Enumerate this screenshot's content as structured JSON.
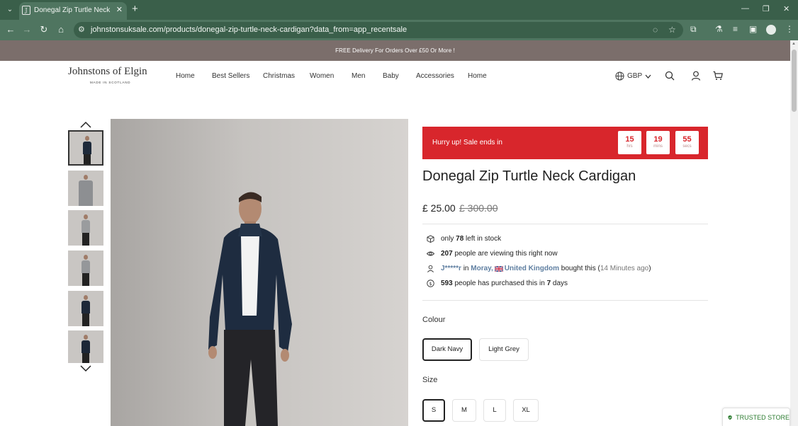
{
  "browser": {
    "tab_title": "Donegal Zip Turtle Neck Cardig",
    "url": "johnstonsuksale.com/products/donegal-zip-turtle-neck-cardigan?data_from=app_recentsale",
    "icons": [
      "tab-list-icon",
      "close-icon",
      "new-tab-icon",
      "minimize-icon",
      "maximize-icon",
      "close-window-icon",
      "back-icon",
      "forward-icon",
      "reload-icon",
      "home-icon",
      "site-info-icon",
      "eye-off-icon",
      "bookmark-star-icon",
      "extensions-icon",
      "labs-icon",
      "media-icon",
      "side-panel-icon",
      "profile-icon",
      "kebab-menu-icon"
    ]
  },
  "announcement": "FREE Delivery For Orders Over £50 Or More !",
  "logo": {
    "name": "Johnstons of Elgin",
    "tagline": "MADE IN SCOTLAND"
  },
  "nav": [
    "Home",
    "Best Sellers",
    "Christmas",
    "Women",
    "Men",
    "Baby",
    "Accessories",
    "Home"
  ],
  "currency": "GBP",
  "countdown": {
    "text": "Hurry up!  Sale ends in",
    "hours": "15",
    "hours_label": "hrs",
    "mins": "19",
    "mins_label": "mins",
    "secs": "55",
    "secs_label": "secs"
  },
  "product": {
    "title": "Donegal Zip Turtle Neck Cardigan",
    "price": "£ 25.00",
    "compare_price": "£ 300.00"
  },
  "stock": {
    "pre": "only",
    "count": "78",
    "post": "left in stock"
  },
  "viewing": {
    "count": "207",
    "text": "people are viewing this right now"
  },
  "recent_sale": {
    "buyer": "J*****r",
    "in": "in",
    "city": "Moray,",
    "country": "United Kingdom",
    "action": "bought this",
    "time_open": "(",
    "time": "14 Minutes ago",
    "time_close": ")"
  },
  "purchased": {
    "count": "593",
    "text": "people has purchased this in",
    "days": "7",
    "days_label": "days"
  },
  "colour": {
    "label": "Colour",
    "options": [
      "Dark Navy",
      "Light Grey"
    ],
    "selected": "Dark Navy"
  },
  "size": {
    "label": "Size",
    "options": [
      "S",
      "M",
      "L",
      "XL"
    ],
    "selected": "S"
  },
  "trusted_badge": "TRUSTED STORE",
  "colors": {
    "accent_red": "#d8262c",
    "announcement_bg": "#7b6e6b",
    "browser_frame": "#4f7560",
    "trusted_green": "#2e7d32",
    "buyer_blue": "#5f7fa1"
  }
}
